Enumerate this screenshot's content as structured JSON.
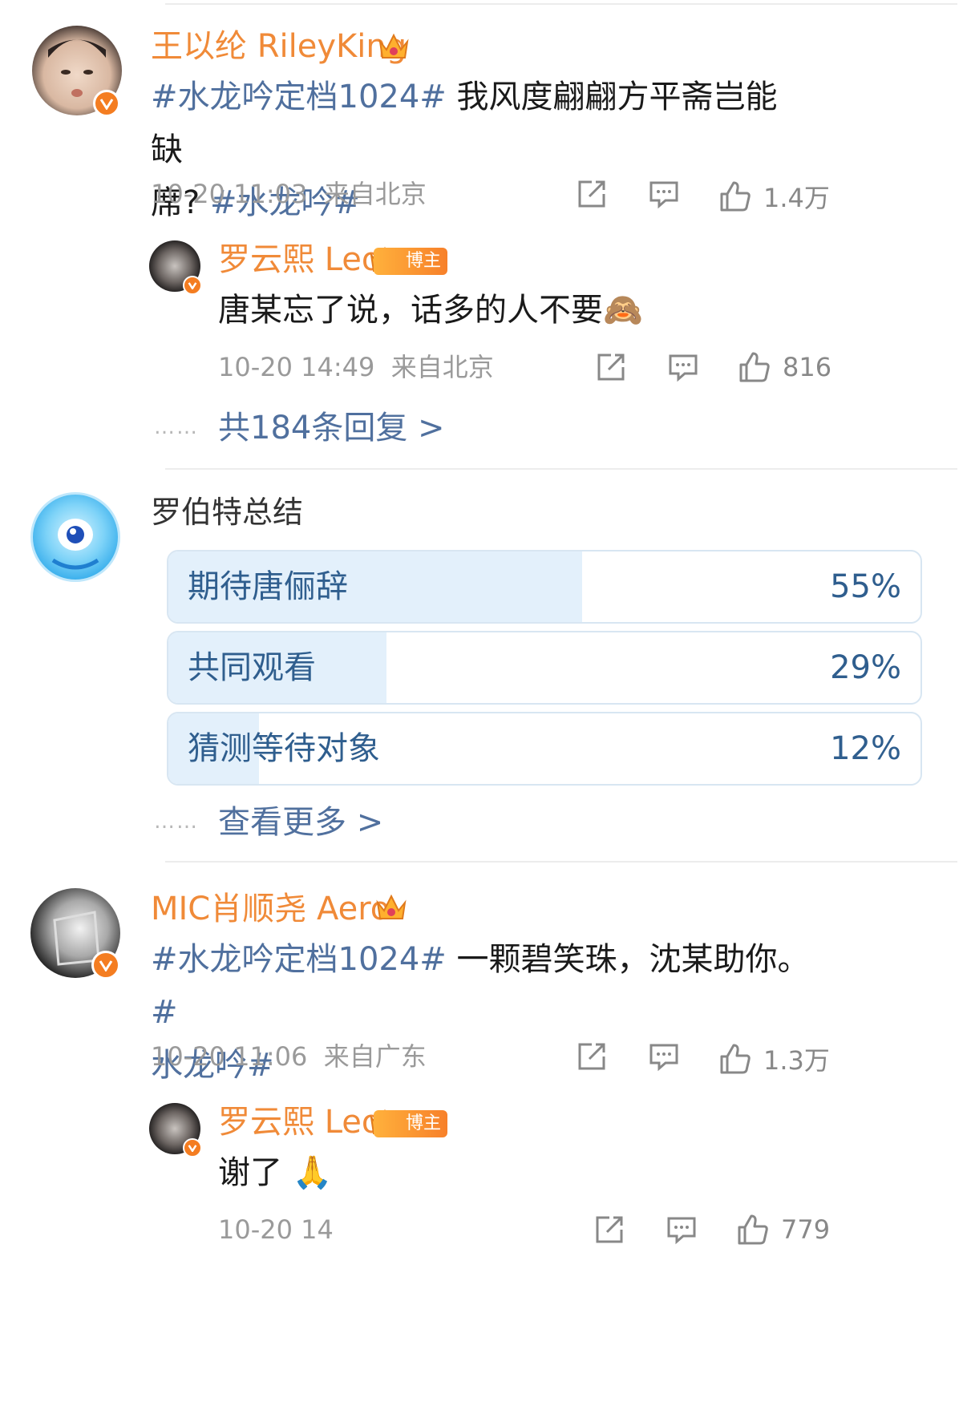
{
  "comments": [
    {
      "name": "王以纶 RileyKing",
      "text_parts": [
        "#水龙吟定档1024#",
        " 我风度翩翩方平斋岂能缺",
        "席? ",
        "#水龙吟#"
      ],
      "time": "10-20 11:03",
      "location": "来自北京",
      "likes": "1.4万",
      "reply": {
        "name": "罗云熙 Leo",
        "badge": "博主",
        "text": "唐某忘了说，话多的人不要",
        "emoji": "🙈",
        "time": "10-20 14:49",
        "location": "来自北京",
        "likes": "816"
      },
      "more_replies": "共184条回复 >"
    },
    {
      "name": "MIC肖顺尧 Aero",
      "text_parts": [
        "#水龙吟定档1024#",
        " 一颗碧笑珠，沈某助你。",
        "#",
        "水龙吟#"
      ],
      "time": "10-20 11:06",
      "location": "来自广东",
      "likes": "1.3万",
      "reply": {
        "name": "罗云熙 Leo",
        "badge": "博主",
        "text": "谢了",
        "emoji": "🙏",
        "time": "10-20 14",
        "likes": "779"
      }
    }
  ],
  "poll": {
    "title": "罗伯特总结",
    "options": [
      {
        "label": "期待唐俪辞",
        "percent_text": "55%",
        "percent": 55
      },
      {
        "label": "共同观看",
        "percent_text": "29%",
        "percent": 29
      },
      {
        "label": "猜测等待对象",
        "percent_text": "12%",
        "percent": 12
      }
    ],
    "more": "查看更多 >"
  },
  "dots": "……",
  "colors": {
    "name": "#f08a38",
    "topic": "#50709e",
    "meta": "#9a9a9a",
    "poll_fill": "#e3f0fb",
    "verified": "#f47d21"
  }
}
